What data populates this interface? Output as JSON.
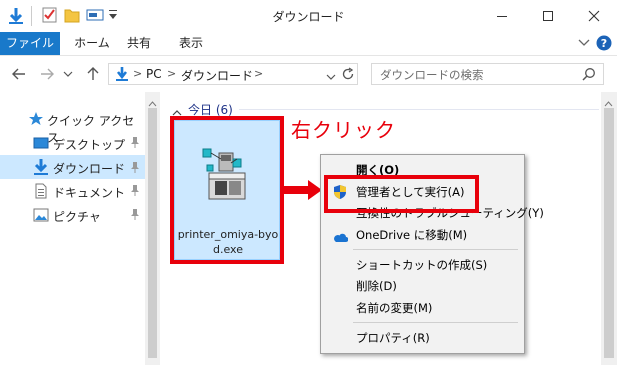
{
  "window": {
    "title": "ダウンロード",
    "ribbon_tabs": [
      "ファイル",
      "ホーム",
      "共有",
      "表示"
    ]
  },
  "address": {
    "pc": "PC",
    "separator": ">",
    "folder": "ダウンロード",
    "search_placeholder": "ダウンロードの検索"
  },
  "navigation": {
    "items": [
      {
        "label": "クイック アクセス",
        "icon": "star-icon"
      },
      {
        "label": "デスクトップ",
        "icon": "desktop-icon"
      },
      {
        "label": "ダウンロード",
        "icon": "download-icon",
        "selected": true
      },
      {
        "label": "ドキュメント",
        "icon": "document-icon"
      },
      {
        "label": "ピクチャ",
        "icon": "picture-icon"
      }
    ]
  },
  "content": {
    "group_label": "今日 (6)",
    "file_name": "printer_omiya-byod.exe",
    "callout": "右クリック"
  },
  "context_menu": {
    "items": [
      {
        "label": "開く(O)"
      },
      {
        "label": "管理者として実行(A)",
        "icon": "uac-shield-icon"
      },
      {
        "label": "互換性のトラブルシューティング(Y)"
      },
      {
        "label": "OneDrive に移動(M)",
        "icon": "onedrive-icon"
      },
      {
        "label": "ショートカットの作成(S)"
      },
      {
        "label": "削除(D)"
      },
      {
        "label": "名前の変更(M)"
      },
      {
        "label": "プロパティ(R)"
      }
    ]
  },
  "colors": {
    "accent": "#1979ca",
    "highlight_red": "#e8000b",
    "selection": "#cce8ff"
  }
}
